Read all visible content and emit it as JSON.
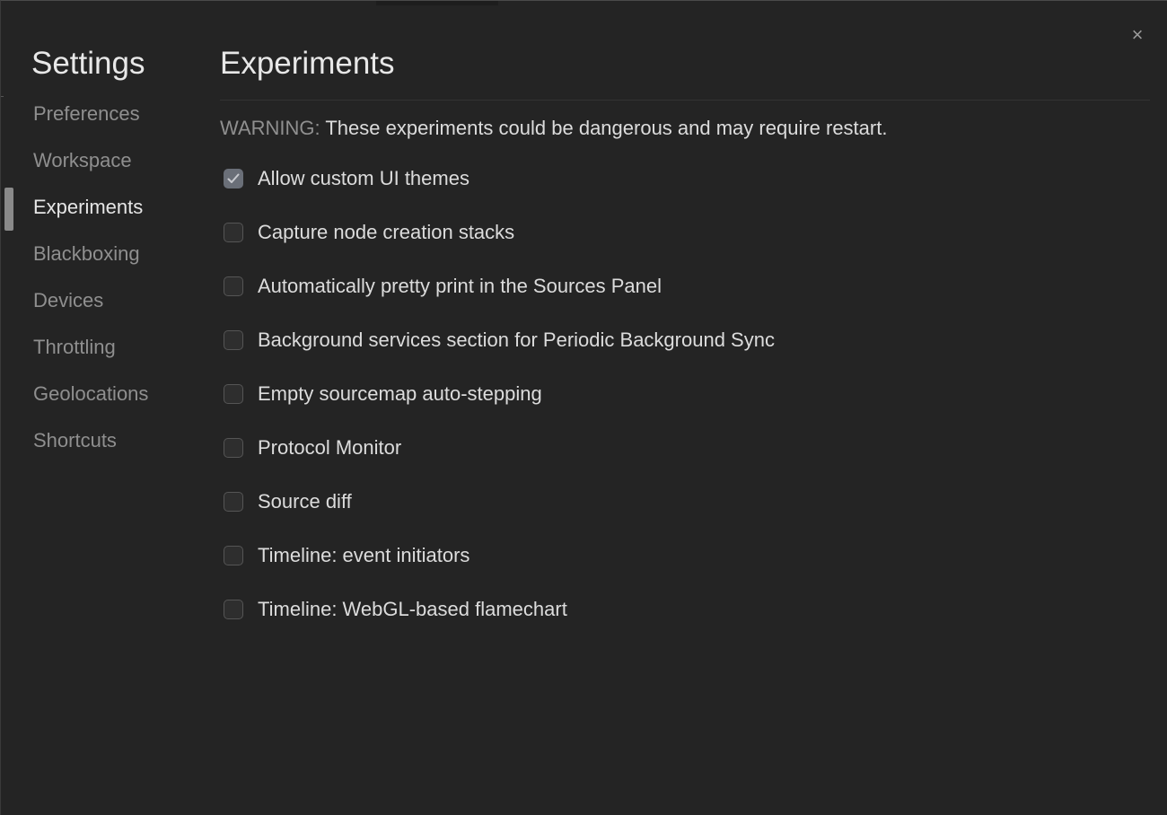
{
  "window": {
    "close_glyph": "×"
  },
  "sidebar": {
    "title": "Settings",
    "items": [
      {
        "label": "Preferences",
        "selected": false
      },
      {
        "label": "Workspace",
        "selected": false
      },
      {
        "label": "Experiments",
        "selected": true
      },
      {
        "label": "Blackboxing",
        "selected": false
      },
      {
        "label": "Devices",
        "selected": false
      },
      {
        "label": "Throttling",
        "selected": false
      },
      {
        "label": "Geolocations",
        "selected": false
      },
      {
        "label": "Shortcuts",
        "selected": false
      }
    ]
  },
  "main": {
    "title": "Experiments",
    "warning_label": "WARNING:",
    "warning_text": " These experiments could be dangerous and may require restart.",
    "experiments": [
      {
        "label": "Allow custom UI themes",
        "checked": true
      },
      {
        "label": "Capture node creation stacks",
        "checked": false
      },
      {
        "label": "Automatically pretty print in the Sources Panel",
        "checked": false
      },
      {
        "label": "Background services section for Periodic Background Sync",
        "checked": false
      },
      {
        "label": "Empty sourcemap auto-stepping",
        "checked": false
      },
      {
        "label": "Protocol Monitor",
        "checked": false
      },
      {
        "label": "Source diff",
        "checked": false
      },
      {
        "label": "Timeline: event initiators",
        "checked": false
      },
      {
        "label": "Timeline: WebGL-based flamechart",
        "checked": false
      }
    ]
  },
  "colors": {
    "background": "#242424",
    "text_primary": "#dcdcdc",
    "text_muted": "#8f8f8f",
    "checkbox_checked": "#6a6f78"
  }
}
